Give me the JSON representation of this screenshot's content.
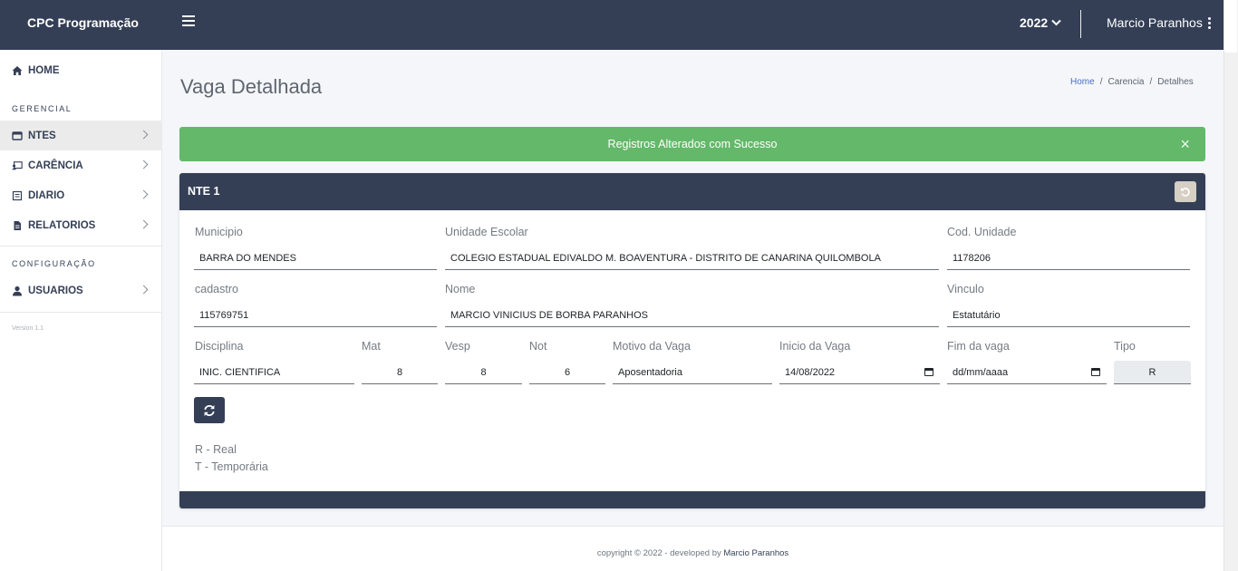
{
  "topbar": {
    "brand": "CPC Programação",
    "year": "2022",
    "user_name": "Marcio Paranhos"
  },
  "sidebar": {
    "home": "HOME",
    "section_gerencial": "GERENCIAL",
    "items": [
      {
        "label": "NTES",
        "icon": "window-icon"
      },
      {
        "label": "CARÊNCIA",
        "icon": "user-board-icon"
      },
      {
        "label": "DIARIO",
        "icon": "list-box-icon"
      },
      {
        "label": "RELATORIOS",
        "icon": "report-file-icon"
      }
    ],
    "section_config": "CONFIGURAÇÃO",
    "usuarios": "USUARIOS",
    "version": "Version 1.1"
  },
  "page": {
    "title": "Vaga Detalhada",
    "breadcrumb": {
      "home": "Home",
      "sep1": "/",
      "carencia": "Carencia",
      "sep2": "/",
      "current": "Detalhes"
    }
  },
  "alert": {
    "message": "Registros Alterados com Sucesso",
    "close": "×",
    "color": "#63b869"
  },
  "card": {
    "title": "NTE 1",
    "fields": {
      "municipio": {
        "label": "Municipio",
        "value": "BARRA DO MENDES"
      },
      "unidade_escolar": {
        "label": "Unidade Escolar",
        "value": "COLEGIO ESTADUAL EDIVALDO M. BOAVENTURA - DISTRITO DE CANARINA  QUILOMBOLA"
      },
      "cod_unidade": {
        "label": "Cod. Unidade",
        "value": "1178206"
      },
      "cadastro": {
        "label": "cadastro",
        "value": "115769751"
      },
      "nome": {
        "label": "Nome",
        "value": "MARCIO VINICIUS DE BORBA PARANHOS"
      },
      "vinculo": {
        "label": "Vinculo",
        "value": "Estatutário"
      },
      "disciplina": {
        "label": "Disciplina",
        "value": "INIC. CIENTIFICA"
      },
      "mat": {
        "label": "Mat",
        "value": "8"
      },
      "vesp": {
        "label": "Vesp",
        "value": "8"
      },
      "not": {
        "label": "Not",
        "value": "6"
      },
      "motivo": {
        "label": "Motivo da Vaga",
        "value": "Aposentadoria"
      },
      "inicio": {
        "label": "Inicio da Vaga",
        "value": "14/08/2022"
      },
      "fim": {
        "label": "Fim da vaga",
        "value": "dd/mm/aaaa"
      },
      "tipo": {
        "label": "Tipo",
        "value": "R"
      }
    },
    "legend": [
      "R - Real",
      "T - Temporária"
    ]
  },
  "footer": {
    "prefix": "copyright © 2022 - developed by",
    "author": "Marcio Paranhos"
  },
  "colors": {
    "navy": "#343f56",
    "success": "#63b869",
    "link": "#4a6fc4"
  }
}
